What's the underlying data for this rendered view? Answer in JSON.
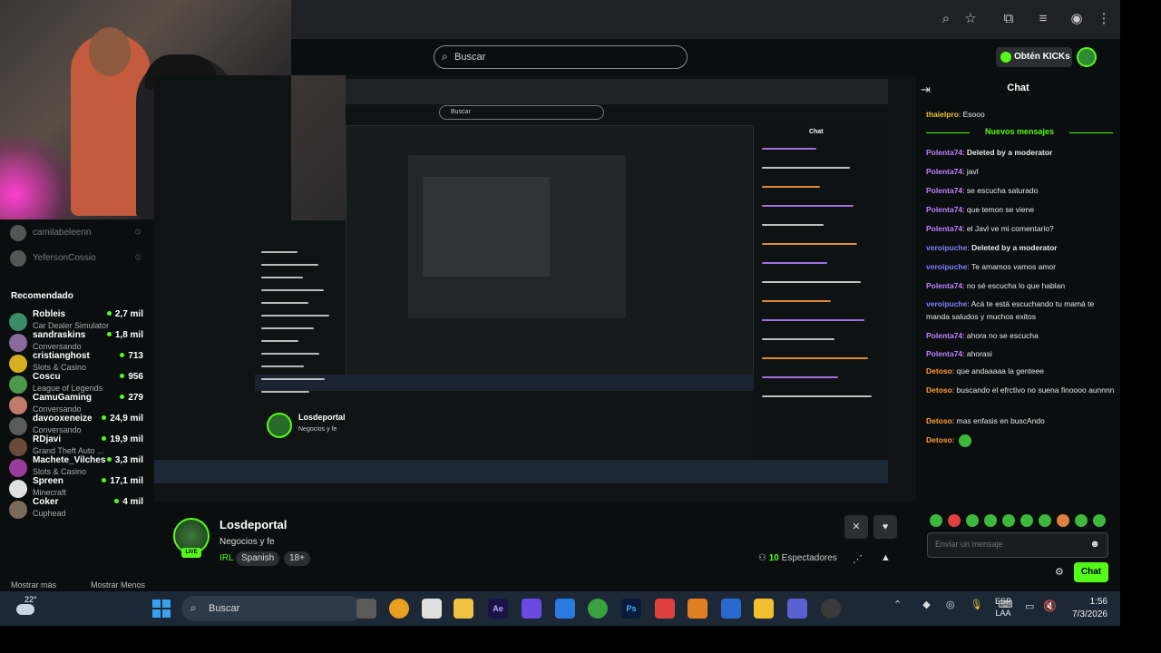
{
  "header": {
    "search_placeholder": "Buscar",
    "kicks_label": "Obtén KICKs"
  },
  "sidebar": {
    "following": [
      {
        "name": "camilabeleenn"
      },
      {
        "name": "YefersonCossio"
      }
    ],
    "recommended_title": "Recomendado",
    "recommended": [
      {
        "name": "Robleis",
        "category": "Car Dealer Simulator",
        "viewers": "2,7 mil",
        "color": "#3a8c6a"
      },
      {
        "name": "sandraskins",
        "category": "Conversando",
        "viewers": "1,8 mil",
        "color": "#8a6a9a"
      },
      {
        "name": "cristianghost",
        "category": "Slots & Casino",
        "viewers": "713",
        "color": "#d4b020"
      },
      {
        "name": "Coscu",
        "category": "League of Legends",
        "viewers": "956",
        "color": "#4a9a4a"
      },
      {
        "name": "CamuGaming",
        "category": "Conversando",
        "viewers": "279",
        "color": "#c07a6a"
      },
      {
        "name": "davooxeneize",
        "category": "Conversando",
        "viewers": "24,9 mil",
        "color": "#5a5a5a"
      },
      {
        "name": "RDjavi",
        "category": "Grand Theft Auto ...",
        "viewers": "19,9 mil",
        "color": "#6a4a3a"
      },
      {
        "name": "Machete_Vilches",
        "category": "Slots & Casino",
        "viewers": "3,3 mil",
        "color": "#9a3a9a"
      },
      {
        "name": "Spreen",
        "category": "Minecraft",
        "viewers": "17,1 mil",
        "color": "#e0e0e0"
      },
      {
        "name": "Coker",
        "category": "Cuphead",
        "viewers": "4 mil",
        "color": "#7a6a5a"
      }
    ],
    "show_more": "Mostrar más",
    "show_less": "Mostrar Menos"
  },
  "nested": {
    "search": "Buscar",
    "chat_title": "Chat",
    "streamer": "Losdeportal",
    "subtitle": "Negocios y fe"
  },
  "stream": {
    "name": "Losdeportal",
    "title": "Negocios y fe",
    "category": "IRL",
    "tags": [
      "Spanish",
      "18+"
    ],
    "live": "LIVE",
    "viewers_count": "10",
    "viewers_label": "Espectadores"
  },
  "chat": {
    "title": "Chat",
    "divider": "Nuevos mensajes",
    "messages": [
      {
        "user": "thaielpro",
        "color": "#f0c030",
        "text": "Esooo"
      },
      {
        "user": "Polenta74",
        "color": "#c080ff",
        "text": "Deleted by a moderator",
        "bold": true
      },
      {
        "user": "Polenta74",
        "color": "#c080ff",
        "text": "javl"
      },
      {
        "user": "Polenta74",
        "color": "#c080ff",
        "text": "se escucha saturado"
      },
      {
        "user": "Polenta74",
        "color": "#c080ff",
        "text": "que temon se viene"
      },
      {
        "user": "Polenta74",
        "color": "#c080ff",
        "text": "el Javl ve mi comentario?"
      },
      {
        "user": "veroipuche",
        "color": "#8080ff",
        "text": "Deleted by a moderator",
        "bold": true
      },
      {
        "user": "veroipuche",
        "color": "#8080ff",
        "text": "Te amamos vamos amor"
      },
      {
        "user": "Polenta74",
        "color": "#c080ff",
        "text": "no sé escucha lo que hablan"
      },
      {
        "user": "veroipuche",
        "color": "#8080ff",
        "text": "Acá te está escuchando tu mamá te manda saludos y muchos exitos"
      },
      {
        "user": "Polenta74",
        "color": "#c080ff",
        "text": "ahora no se escucha"
      },
      {
        "user": "Polenta74",
        "color": "#c080ff",
        "text": "ahorasi"
      },
      {
        "user": "Detoso",
        "color": "#ff9a30",
        "text": "que andaaaaa la genteee"
      },
      {
        "user": "Detoso",
        "color": "#ff9a30",
        "text": "buscando el efrctivo no suena finoooo aunnnn"
      },
      {
        "user": "Detoso",
        "color": "#ff9a30",
        "text": "mas enfasis en buscAndo"
      },
      {
        "user": "Detoso",
        "color": "#ff9a30",
        "text": ""
      }
    ],
    "input_placeholder": "Enviar un mensaje",
    "send_label": "Chat"
  },
  "taskbar": {
    "temperature": "22°",
    "search": "Buscar",
    "lang_top": "ESP",
    "lang_bottom": "LAA",
    "time": "1:56",
    "date": "7/3/2026",
    "app_ae": "Ae",
    "app_ps": "Ps"
  }
}
